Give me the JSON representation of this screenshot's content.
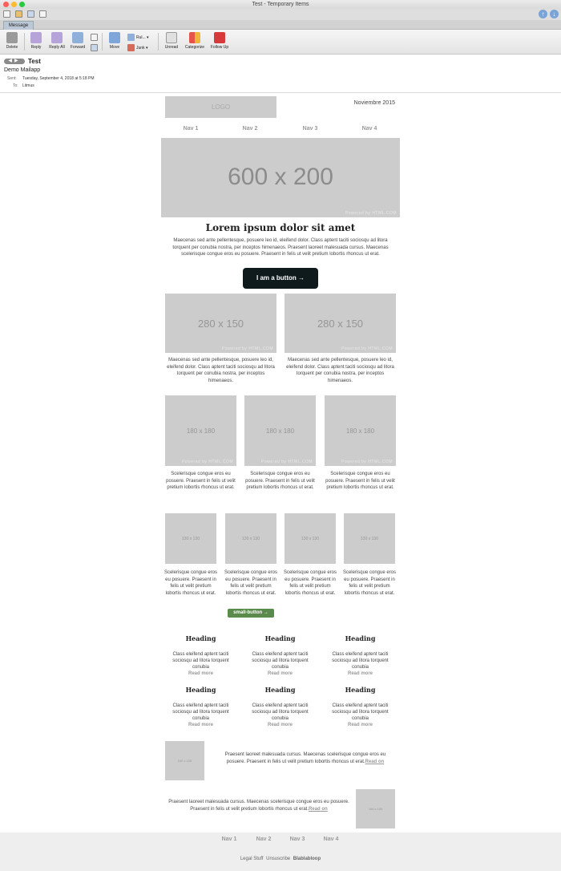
{
  "window": {
    "title": "Test - Temporary Items"
  },
  "tabs": {
    "message": "Message"
  },
  "ribbon": {
    "delete": "Delete",
    "reply": "Reply",
    "reply_all": "Reply All",
    "forward": "Forward",
    "move": "Move",
    "rules": "Rul...",
    "junk": "Junk",
    "unread": "Unread",
    "categorize": "Categorize",
    "follow_up": "Follow Up"
  },
  "message": {
    "subject": "Test",
    "from": "Demo Mailapp",
    "sent_label": "Sent:",
    "sent_value": "Tuesday, September 4, 2018 at 5:18 PM",
    "to_label": "To:",
    "to_value": "Litmus"
  },
  "email": {
    "logo": "LOGO",
    "date": "Noviembre 2015",
    "nav": [
      "Nav 1",
      "Nav 2",
      "Nav 3",
      "Nav 4"
    ],
    "hero": {
      "label": "600 x 200",
      "credit": "Powered by HTML.COM"
    },
    "headline": "Lorem ipsum dolor sit amet",
    "intro": "Maecenas sed ante pellentesque, posuere leo id, eleifend dolor. Class aptent taciti sociosqu ad litora torquent per conubia nostra, per inceptos himenaeos. Praesent laoreet malesuada cursus. Maecenas scelerisque congue eros eu posuere. Praesent in felis ut velit pretium lobortis rhoncus ut erat.",
    "main_button": "I am a button →",
    "two_col": {
      "image_label": "280 x 150",
      "credit": "Powered by HTML.COM",
      "text": "Maecenas sed ante pellentesque, posuere leo id, eleifend dolor. Class aptent taciti sociosqu ad litora torquent per conubia nostra, per inceptos himenaeos."
    },
    "three_col": {
      "image_label": "180 x 180",
      "credit": "Powered by HTML.COM",
      "text": "Scelerisque congue eros eu posuere. Praesent in felis ut velit pretium lobortis rhoncus ut erat."
    },
    "four_col": {
      "image_label": "130 x 130",
      "text": "Scelerisque congue eros eu posuere. Praesent in felis ut velit pretium lobortis rhoncus ut erat."
    },
    "small_button": "small-button →",
    "heading_grid": {
      "heading": "Heading",
      "text": "Class eleifend aptent taciti sociosqu ad litora torquent conubia",
      "read_more": "Read more"
    },
    "side_rows": {
      "image_label": "100 x 100",
      "text": "Praesent laoreet malesuada cursus. Maecenas scelerisque congue eros eu posuere. Praesent in felis ut velit pretium lobortis rhoncus ut erat.",
      "read_on": "Read on"
    }
  },
  "footer": {
    "nav": [
      "Nav 1",
      "Nav 2",
      "Nav 3",
      "Nav 4"
    ],
    "legal": "Legal Stuff",
    "unsubscribe": "Unsuscribe",
    "brand": "Blablabloop"
  }
}
